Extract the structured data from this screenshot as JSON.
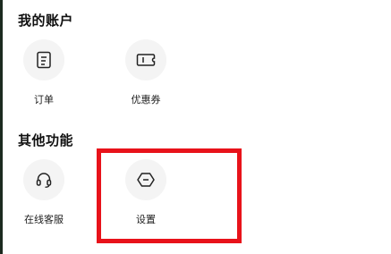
{
  "sections": {
    "account": {
      "title": "我的账户",
      "items": [
        {
          "label": "订单",
          "icon": "order-list-icon"
        },
        {
          "label": "优惠券",
          "icon": "coupon-ticket-icon"
        }
      ]
    },
    "other": {
      "title": "其他功能",
      "items": [
        {
          "label": "在线客服",
          "icon": "headset-icon"
        },
        {
          "label": "设置",
          "icon": "settings-hexagon-icon"
        }
      ]
    }
  },
  "colors": {
    "highlight": "#e8121a",
    "icon_bg": "#f4f4f4",
    "text": "#111111"
  }
}
